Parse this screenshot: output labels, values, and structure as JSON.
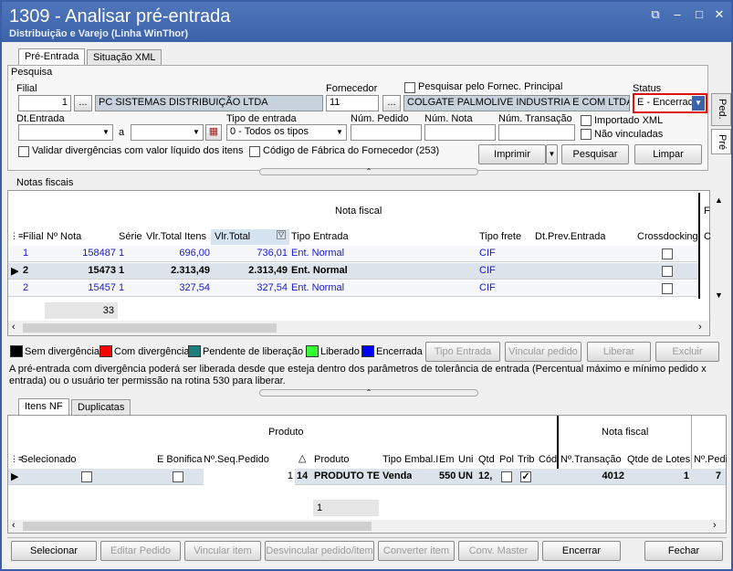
{
  "window": {
    "title": "1309 - Analisar pré-entrada",
    "subtitle": "Distribuição e Varejo (Linha WinThor)"
  },
  "tabs_top": [
    "Pré-Entrada",
    "Situação XML"
  ],
  "pesquisa": {
    "section_label": "Pesquisa",
    "filial_label": "Filial",
    "filial_value": "1",
    "filial_name": "PC SISTEMAS DISTRIBUIÇÃO LTDA",
    "fornecedor_label": "Fornecedor",
    "fornecedor_value": "11",
    "fornecedor_name": "COLGATE PALMOLIVE INDUSTRIA  E COM LTDA",
    "pesquisar_fornec_label": "Pesquisar pelo Fornec. Principal",
    "status_label": "Status",
    "status_value": "E - Encerrad",
    "dt_entrada_label": "Dt.Entrada",
    "a_label": "a",
    "tipo_entrada_label": "Tipo de entrada",
    "tipo_entrada_value": "0 - Todos os tipos",
    "num_pedido_label": "Núm. Pedido",
    "num_nota_label": "Núm. Nota",
    "num_transacao_label": "Núm. Transação",
    "importado_xml_label": "Importado XML",
    "nao_vinculadas_label": "Não vinculadas",
    "validar_label": "Validar divergências com valor líquido dos itens",
    "codigo_fabrica_label": "Código de Fábrica do Fornecedor (253)",
    "imprimir_label": "Imprimir",
    "pesquisar_label": "Pesquisar",
    "limpar_label": "Limpar",
    "dots": "..."
  },
  "side_tabs": [
    "Ped.",
    "Pré"
  ],
  "notas": {
    "section_label": "Notas fiscais",
    "group_header": "Nota fiscal",
    "group_header2": "F",
    "columns": [
      "Filial",
      "Nº Nota",
      "Série",
      "Vlr.Total Itens",
      "Vlr.Total",
      "Tipo Entrada",
      "Tipo frete",
      "Dt.Prev.Entrada",
      "Crossdocking",
      "C"
    ],
    "rows": [
      {
        "filial": "1",
        "nota": "158487",
        "serie": "1",
        "vlr_itens": "696,00",
        "vlr_total": "736,01",
        "tipo": "Ent. Normal",
        "frete": "CIF"
      },
      {
        "filial": "2",
        "nota": "15473",
        "serie": "1",
        "vlr_itens": "2.313,49",
        "vlr_total": "2.313,49",
        "tipo": "Ent. Normal",
        "frete": "CIF"
      },
      {
        "filial": "2",
        "nota": "15457",
        "serie": "1",
        "vlr_itens": "327,54",
        "vlr_total": "327,54",
        "tipo": "Ent. Normal",
        "frete": "CIF"
      }
    ],
    "count": "33"
  },
  "legend": {
    "items": [
      {
        "label": "Sem divergência",
        "color": "#000000"
      },
      {
        "label": "Com divergência",
        "color": "#ff0000"
      },
      {
        "label": "Pendente de liberação",
        "color": "#1e7d7d"
      },
      {
        "label": "Liberado",
        "color": "#33ff33"
      },
      {
        "label": "Encerrada",
        "color": "#0000ff"
      }
    ],
    "buttons": [
      "Tipo Entrada",
      "Vincular pedido",
      "Liberar",
      "Excluir"
    ]
  },
  "info_text": "A pré-entrada com divergência poderá ser liberada desde que esteja dentro dos parâmetros de tolerância de entrada (Percentual máximo e mínimo pedido x entrada) ou o usuário ter permissão na rotina 530 para liberar.",
  "tabs_bottom": [
    "Itens NF",
    "Duplicatas"
  ],
  "itens": {
    "group_produto": "Produto",
    "group_nota": "Nota fiscal",
    "columns": [
      "Selecionado",
      "E Bonifica",
      "Nº.Seq.Pedido",
      "Produto",
      "Tipo Embal.I",
      "Emb",
      "Uni",
      "Qtd",
      "Pol",
      "Trib",
      "Cód",
      "Nº.Transação",
      "Qtde de Lotes",
      "Nº.Pedi"
    ],
    "row": {
      "seq": "1",
      "cod": "14",
      "produto": "PRODUTO TE",
      "embal": "Venda",
      "emb": "550",
      "uni": "UN",
      "qtd": "12,",
      "transacao": "4012",
      "lotes": "1",
      "pedido": "7"
    },
    "count": "1"
  },
  "bottom_buttons": [
    "Selecionar",
    "Editar Pedido",
    "Vincular item",
    "Desvincular pedido/item",
    "Converter item",
    "Conv. Master",
    "Encerrar",
    "Fechar"
  ],
  "colors": {
    "titlebar": "#3c63aa",
    "encerrada_text": "#0000ff",
    "highlight_border": "#e01010"
  }
}
